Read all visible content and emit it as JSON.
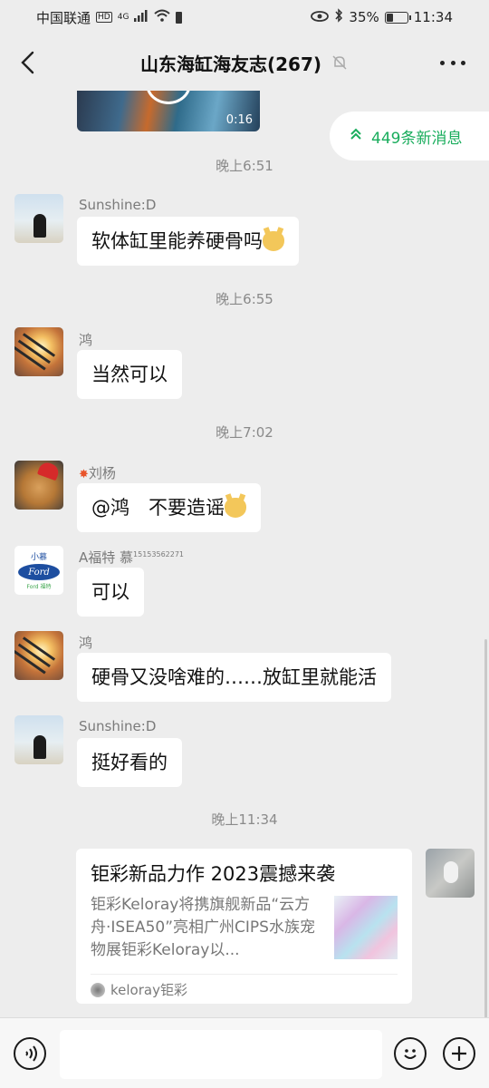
{
  "status_bar": {
    "carrier": "中国联通",
    "network": "4G",
    "battery": "35%",
    "battery_level": 0.35,
    "time": "11:34"
  },
  "header": {
    "title": "山东海缸海友志(267)",
    "back_icon": "chevron-left-icon",
    "mute_icon": "bell-off-icon",
    "more_icon": "more-horizontal-icon"
  },
  "video": {
    "duration": "0:16"
  },
  "new_messages": {
    "label": "449条新消息",
    "icon": "double-chevron-up-icon"
  },
  "messages": [
    {
      "time": "晚上6:51",
      "sender": "Sunshine:D",
      "text": "软体缸里能养硬骨吗"
    },
    {
      "time": "晚上6:55",
      "sender": "鸿",
      "text": "当然可以"
    },
    {
      "time": "晚上7:02",
      "sender": "刘杨",
      "text": "@鸿　不要造谣"
    },
    {
      "sender": "A福特 慕",
      "sender_suffix": "15153562271",
      "text": "可以"
    },
    {
      "sender": "鸿",
      "text": "硬骨又没啥难的……放缸里就能活"
    },
    {
      "sender": "Sunshine:D",
      "text": "挺好看的"
    }
  ],
  "avatar_ford": {
    "top": "小慕",
    "logo": "Ford",
    "bottom": "Ford 福特"
  },
  "share_card": {
    "time": "晚上11:34",
    "title": "钜彩新品力作 2023震撼来袭",
    "desc": "钜彩Keloray将携旗舰新品“云方舟·ISEA50”亮相广州CIPS水族宠物展钜彩Keloray以...",
    "source": "keloray钜彩"
  },
  "input_bar": {
    "voice_icon": "voice-icon",
    "emoji_icon": "emoji-icon",
    "plus_icon": "plus-circle-icon"
  }
}
